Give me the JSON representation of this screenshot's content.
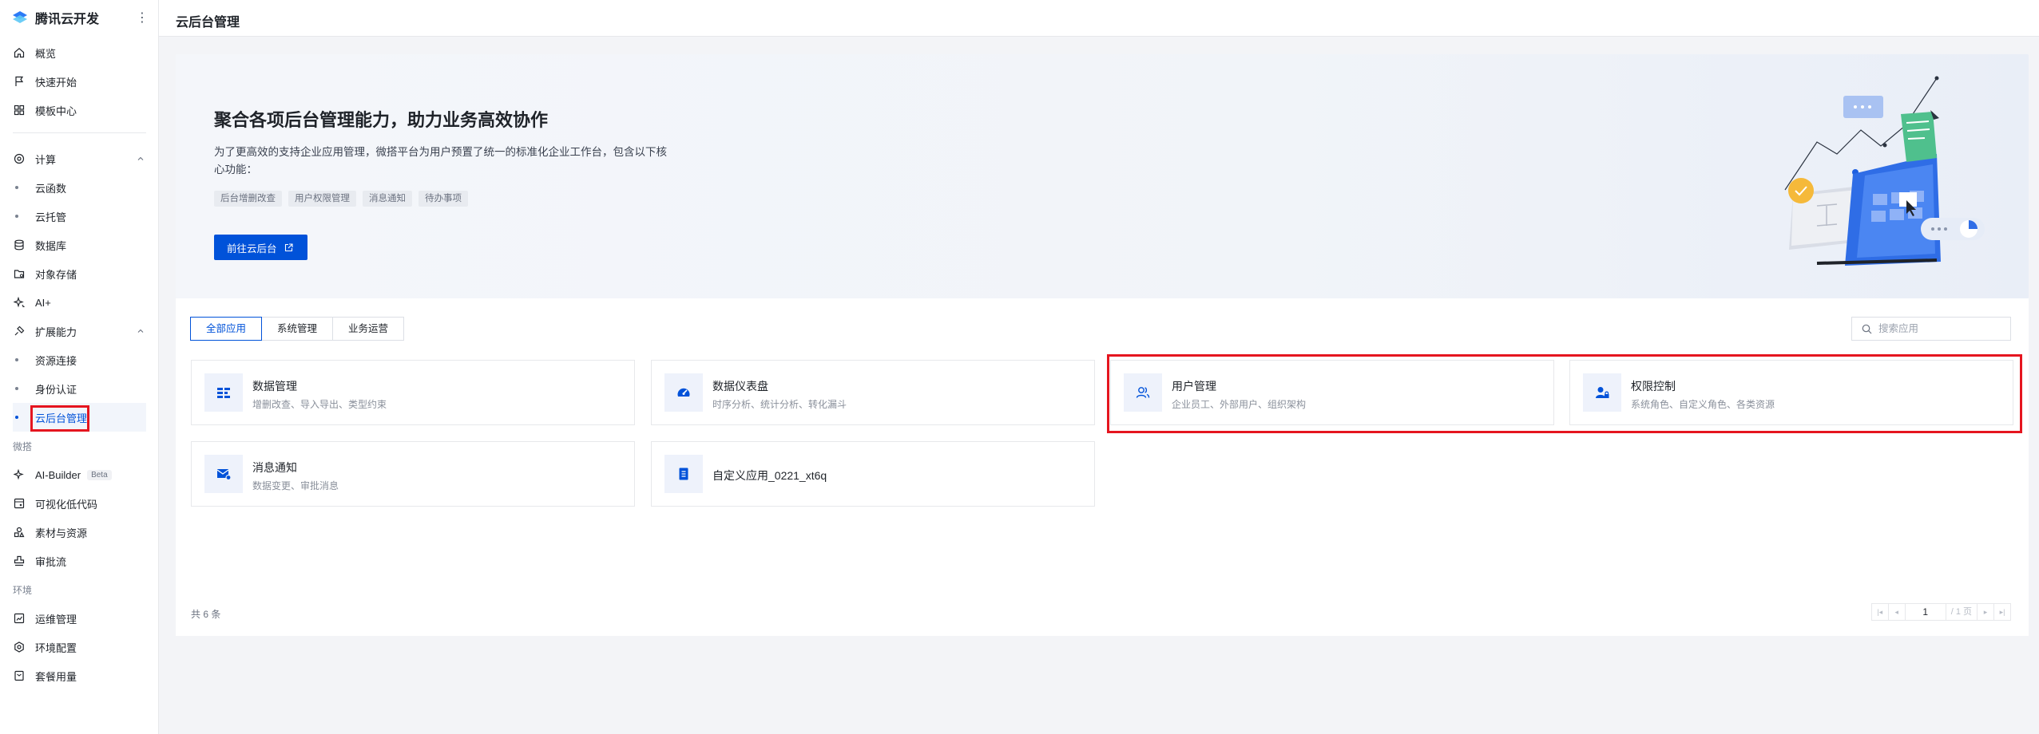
{
  "sidebar": {
    "brand": "腾讯云开发",
    "more_icon": "more-vertical-icon",
    "items": [
      {
        "label": "概览",
        "icon": "home-icon"
      },
      {
        "label": "快速开始",
        "icon": "flag-icon"
      },
      {
        "label": "模板中心",
        "icon": "grid-icon"
      }
    ],
    "compute": {
      "label": "计算",
      "icon": "compute-icon",
      "children": [
        "云函数",
        "云托管"
      ]
    },
    "database": {
      "label": "数据库",
      "icon": "database-icon"
    },
    "storage": {
      "label": "对象存储",
      "icon": "folder-icon"
    },
    "ai": {
      "label": "AI+",
      "icon": "sparkle-icon"
    },
    "extension": {
      "label": "扩展能力",
      "icon": "extension-icon",
      "children": [
        "资源连接",
        "身份认证",
        "云后台管理"
      ],
      "active": "云后台管理"
    },
    "group_micro": "微搭",
    "micro_items": [
      {
        "label": "AI-Builder",
        "badge": "Beta",
        "icon": "sparkle-icon"
      },
      {
        "label": "可视化低代码",
        "icon": "lowcode-icon"
      },
      {
        "label": "素材与资源",
        "icon": "assets-icon"
      },
      {
        "label": "审批流",
        "icon": "stamp-icon"
      }
    ],
    "group_env": "环境",
    "env_items": [
      {
        "label": "运维管理",
        "icon": "ops-icon"
      },
      {
        "label": "环境配置",
        "icon": "config-icon"
      },
      {
        "label": "套餐用量",
        "icon": "package-icon"
      }
    ]
  },
  "header": {
    "title": "云后台管理"
  },
  "banner": {
    "title": "聚合各项后台管理能力，助力业务高效协作",
    "description": "为了更高效的支持企业应用管理，微搭平台为用户预置了统一的标准化企业工作台，包含以下核心功能：",
    "tags": [
      "后台增删改查",
      "用户权限管理",
      "消息通知",
      "待办事项"
    ],
    "button": "前往云后台"
  },
  "tabs": [
    "全部应用",
    "系统管理",
    "业务运营"
  ],
  "active_tab": "全部应用",
  "search": {
    "placeholder": "搜索应用"
  },
  "apps": [
    {
      "title": "数据管理",
      "desc": "增删改查、导入导出、类型约束",
      "icon": "data-management-icon"
    },
    {
      "title": "数据仪表盘",
      "desc": "时序分析、统计分析、转化漏斗",
      "icon": "dashboard-icon"
    },
    {
      "title": "用户管理",
      "desc": "企业员工、外部用户、组织架构",
      "icon": "users-icon"
    },
    {
      "title": "权限控制",
      "desc": "系统角色、自定义角色、各类资源",
      "icon": "permission-icon"
    },
    {
      "title": "消息通知",
      "desc": "数据变更、审批消息",
      "icon": "message-icon"
    },
    {
      "title": "自定义应用_0221_xt6q",
      "desc": "",
      "icon": "document-icon"
    }
  ],
  "pagination": {
    "total": "共 6 条",
    "current": "1",
    "pages": "/ 1 页"
  },
  "colors": {
    "primary": "#0052d9",
    "highlight": "#e5151f"
  }
}
